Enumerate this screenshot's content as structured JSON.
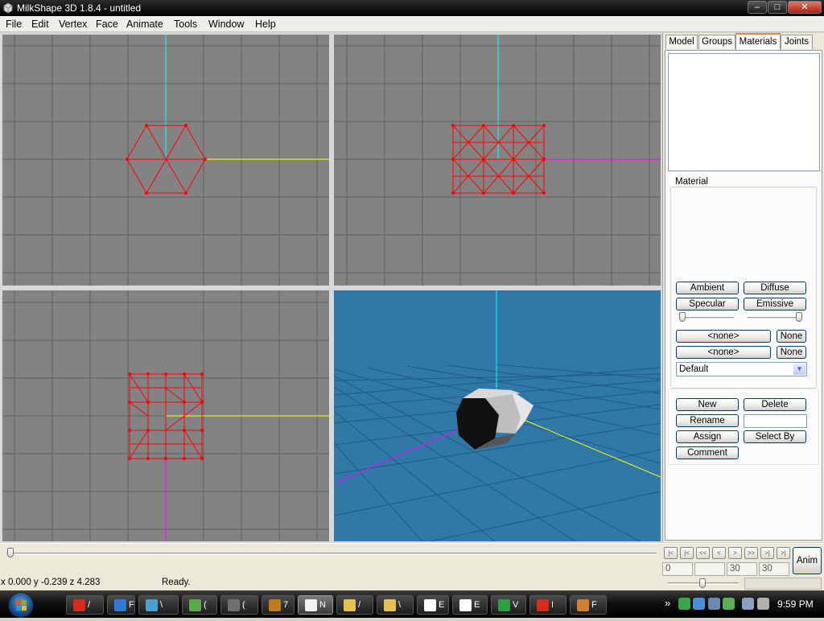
{
  "window": {
    "title": "MilkShape 3D 1.8.4 - untitled",
    "min_glyph": "–",
    "max_glyph": "□",
    "close_glyph": "✕"
  },
  "menu": [
    "File",
    "Edit",
    "Vertex",
    "Face",
    "Animate",
    "Tools",
    "Window",
    "Help"
  ],
  "tabs": [
    "Model",
    "Groups",
    "Materials",
    "Joints"
  ],
  "active_tab": "Materials",
  "materials_panel": {
    "group_label": "Material",
    "ambient": "Ambient",
    "diffuse": "Diffuse",
    "specular": "Specular",
    "emissive": "Emissive",
    "texture1": "<none>",
    "texture1_clear": "None",
    "texture2": "<none>",
    "texture2_clear": "None",
    "mode_select": "Default",
    "new": "New",
    "delete": "Delete",
    "rename": "Rename",
    "rename_value": "",
    "assign": "Assign",
    "select_by": "Select By",
    "comment": "Comment"
  },
  "timeline": {
    "nav": [
      "|<",
      "|<",
      "<<",
      "<",
      ">",
      ">>",
      ">|",
      ">|"
    ],
    "current_frame": "0",
    "field2": "",
    "field3": "30",
    "field4": "30",
    "anim_button": "Anim"
  },
  "status": {
    "coords": "x 0.000 y -0.239 z 4.283",
    "message": "Ready."
  },
  "taskbar": {
    "tasks": [
      {
        "label": "/",
        "color": "#d62b1e"
      },
      {
        "label": "F",
        "color": "#2d7bd6"
      },
      {
        "label": "\\",
        "color": "#4aa0d0"
      },
      {
        "label": "(",
        "color": "#5aa84a"
      },
      {
        "label": "(",
        "color": "#707070"
      },
      {
        "label": "7",
        "color": "#c07a1a"
      },
      {
        "label": "N",
        "color": "#f0f0f0"
      },
      {
        "label": "/",
        "color": "#e6c050"
      },
      {
        "label": "\\",
        "color": "#e6c050"
      },
      {
        "label": "E",
        "color": "#ffffff"
      },
      {
        "label": "E",
        "color": "#ffffff"
      },
      {
        "label": "V",
        "color": "#2aa040"
      },
      {
        "label": "I",
        "color": "#d62b1e"
      },
      {
        "label": "F",
        "color": "#d08030"
      }
    ],
    "clock": "9:59 PM",
    "chevron": "»"
  },
  "colors": {
    "viewport_gray": "#838383",
    "grid_gray": "#5f5f5f",
    "persp_blue": "#2f78a8",
    "mesh_red": "#ff0000",
    "axis_cyan": "#00ffff",
    "axis_yellow": "#ffff00",
    "axis_magenta": "#ff00ff"
  }
}
